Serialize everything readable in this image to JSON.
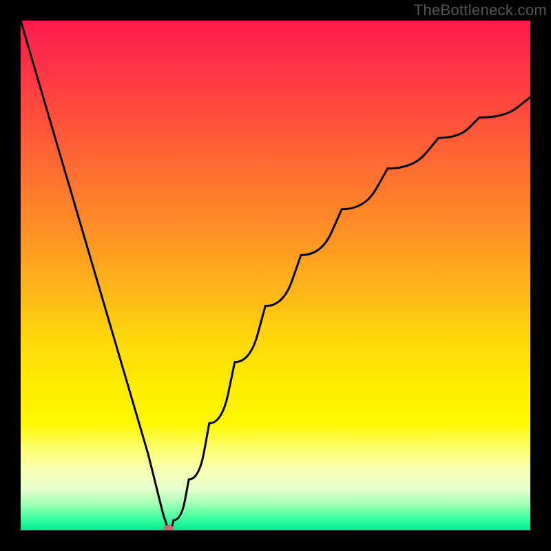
{
  "watermark": "TheBottleneck.com",
  "chart_data": {
    "type": "line",
    "title": "",
    "xlabel": "",
    "ylabel": "",
    "xlim": [
      0,
      100
    ],
    "ylim": [
      0,
      100
    ],
    "grid": false,
    "legend": false,
    "notes": "V-shaped bottleneck curve on rainbow gradient; minimum near x≈29; left branch steep linear, right branch concave rising toward ~85 at x=100.",
    "series": [
      {
        "name": "bottleneck-curve",
        "x": [
          0,
          5,
          10,
          15,
          20,
          25,
          28,
          29,
          30,
          33,
          37,
          42,
          48,
          55,
          63,
          72,
          82,
          90,
          100
        ],
        "y": [
          100,
          83,
          66,
          49,
          32,
          15,
          3,
          0,
          2,
          10,
          21,
          33,
          44,
          54,
          63,
          71,
          77,
          81,
          85
        ]
      }
    ],
    "marker": {
      "x": 29,
      "y": 0,
      "color": "#c96a6a"
    }
  },
  "colors": {
    "curve": "#000000",
    "marker": "#c96a6a",
    "frame": "#000000"
  }
}
